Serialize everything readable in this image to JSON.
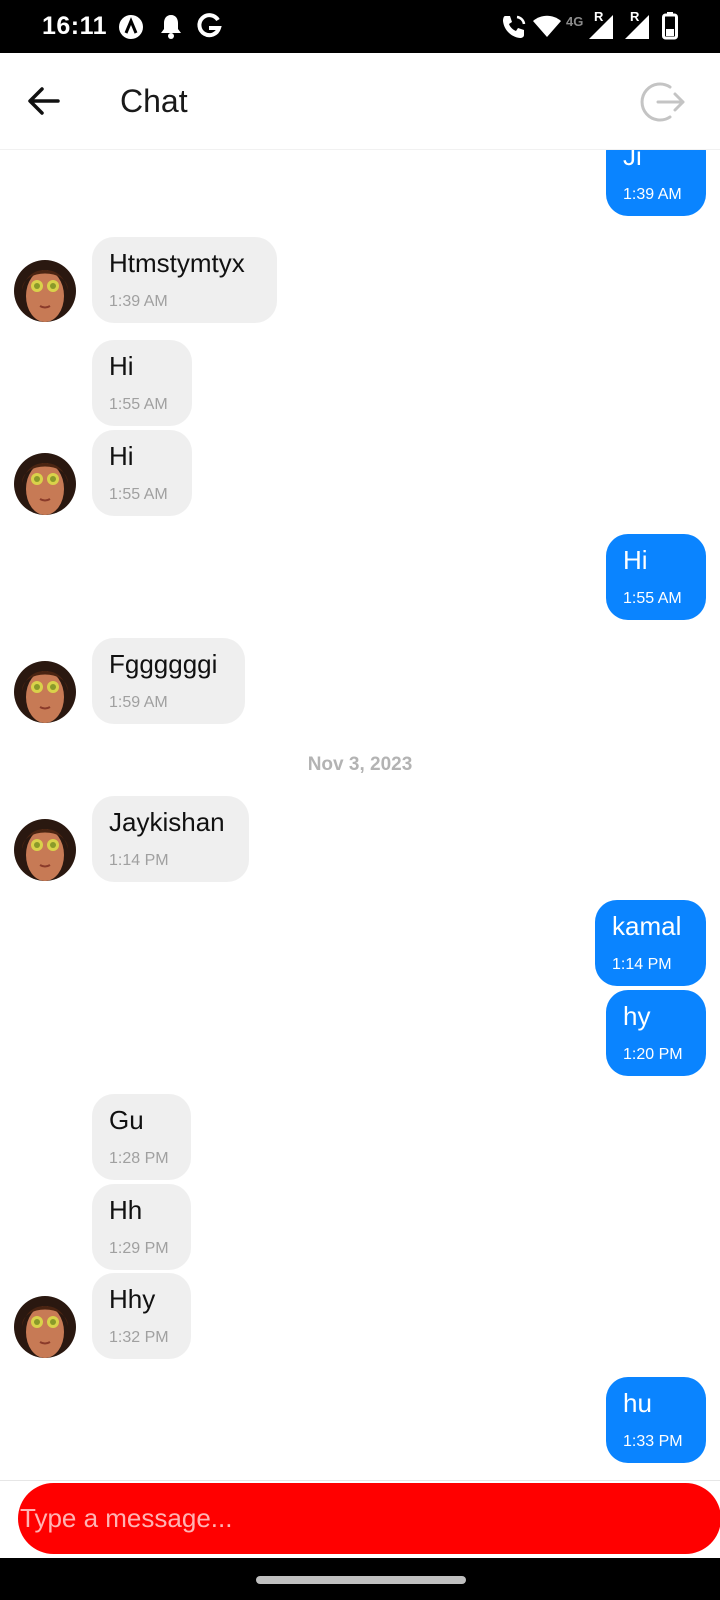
{
  "status_bar": {
    "time": "16:11",
    "network_label": "4G",
    "roaming_label_1": "R",
    "roaming_label_2": "R",
    "left_icons": [
      "app-a-icon",
      "notification-bell-icon",
      "google-g-icon"
    ],
    "right_icons": [
      "wifi-calling-icon",
      "wifi-icon",
      "signal-icon",
      "signal-icon",
      "battery-icon"
    ]
  },
  "app_bar": {
    "title": "Chat",
    "back_icon": "arrow-left-icon",
    "logout_icon": "logout-icon"
  },
  "messages": [
    {
      "direction": "out",
      "text": "Ji",
      "time": "1:39 AM"
    },
    {
      "direction": "in",
      "text": "Htmstymtyx",
      "time": "1:39 AM",
      "avatar": true
    },
    {
      "direction": "in",
      "text": "Hi",
      "time": "1:55 AM"
    },
    {
      "direction": "in",
      "text": "Hi",
      "time": "1:55 AM",
      "avatar": true
    },
    {
      "direction": "out",
      "text": "Hi",
      "time": "1:55 AM"
    },
    {
      "direction": "in",
      "text": "Fggggggi",
      "time": "1:59 AM",
      "avatar": true
    },
    {
      "type": "date",
      "text": "Nov 3, 2023"
    },
    {
      "direction": "in",
      "text": "Jaykishan",
      "time": "1:14 PM",
      "avatar": true
    },
    {
      "direction": "out",
      "text": "kamal",
      "time": "1:14 PM"
    },
    {
      "direction": "out",
      "text": "hy",
      "time": "1:20 PM"
    },
    {
      "direction": "in",
      "text": "Gu",
      "time": "1:28 PM"
    },
    {
      "direction": "in",
      "text": "Hh",
      "time": "1:29 PM"
    },
    {
      "direction": "in",
      "text": "Hhy",
      "time": "1:32 PM",
      "avatar": true
    },
    {
      "direction": "out",
      "text": "hu",
      "time": "1:33 PM"
    }
  ],
  "composer": {
    "placeholder": "Type a message...",
    "value": ""
  },
  "colors": {
    "outgoing_bubble": "#0a84ff",
    "incoming_bubble": "#efefef",
    "composer_background": "#ff0000",
    "status_bar": "#000000",
    "date_separator_text": "#b3b3b3"
  }
}
